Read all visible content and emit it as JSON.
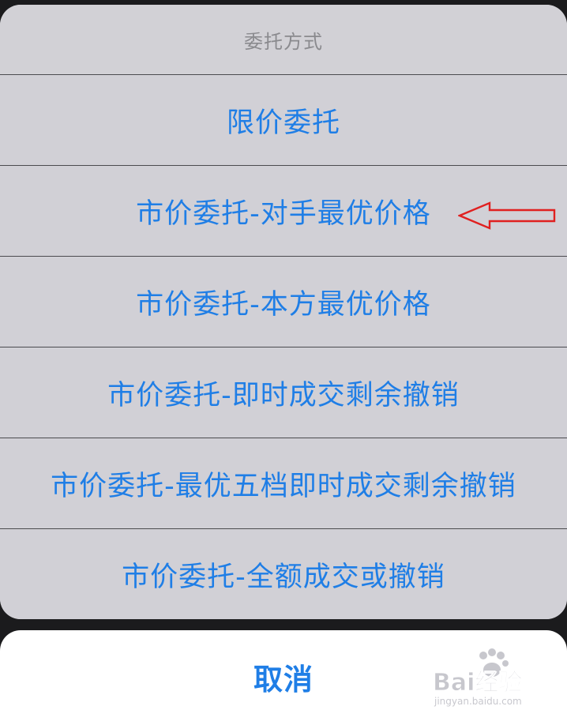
{
  "action_sheet": {
    "title": "委托方式",
    "items": [
      {
        "label": "限价委托"
      },
      {
        "label": "市价委托-对手最优价格"
      },
      {
        "label": "市价委托-本方最优价格"
      },
      {
        "label": "市价委托-即时成交剩余撤销"
      },
      {
        "label": "市价委托-最优五档即时成交剩余撤销"
      },
      {
        "label": "市价委托-全额成交或撤销"
      }
    ],
    "cancel_label": "取消"
  },
  "annotation": {
    "type": "arrow-icon",
    "color": "#e02020"
  },
  "watermark": {
    "logo_text": "Bai经验",
    "url_text": "jingyan.baidu.com"
  }
}
